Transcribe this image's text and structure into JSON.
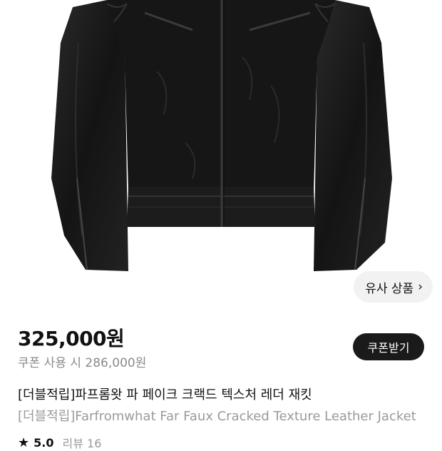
{
  "product": {
    "similar_button": "유사 상품",
    "price": "325,000원",
    "coupon_price_text": "쿠폰 사용 시 286,000원",
    "coupon_button": "쿠폰받기",
    "title_ko": "[더블적립]파프롬왓 파 페이크 크랙드 텍스처 레더 재킷",
    "title_en": "[더블적립]Farfromwhat Far Faux Cracked Texture Leather Jacket",
    "rating_score": "5.0",
    "review_text": "리뷰 16"
  },
  "icons": {
    "similar_chevron": "chevron-right-icon",
    "rating_star": "star-icon"
  },
  "colors": {
    "coupon_button_bg": "#1a1a1a",
    "similar_button_bg": "#f2f2f2",
    "muted_text": "#8a8a8a"
  }
}
